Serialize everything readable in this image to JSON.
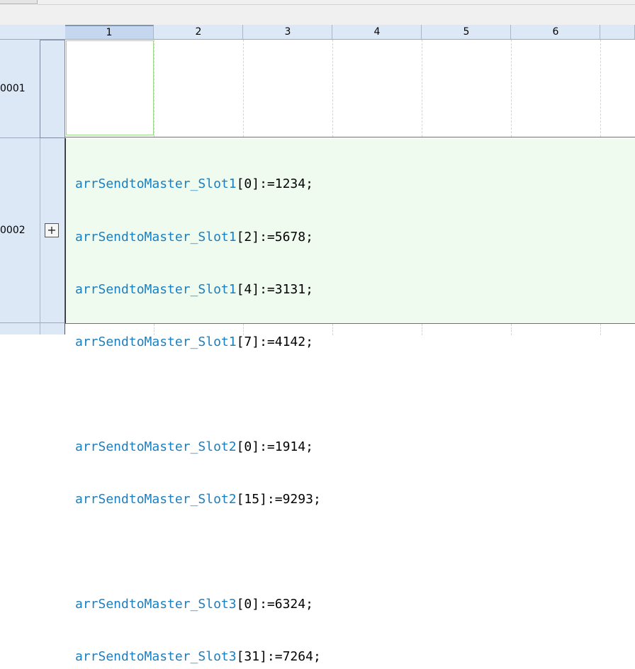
{
  "columns": [
    "1",
    "2",
    "3",
    "4",
    "5",
    "6"
  ],
  "rows": [
    {
      "number": "0001"
    },
    {
      "number": "0002",
      "expand_glyph": "+"
    }
  ],
  "code": [
    {
      "ident": "arrSendtoMaster_Slot1",
      "rest": "[0]:=1234;"
    },
    {
      "ident": "arrSendtoMaster_Slot1",
      "rest": "[2]:=5678;"
    },
    {
      "ident": "arrSendtoMaster_Slot1",
      "rest": "[4]:=3131;"
    },
    {
      "ident": "arrSendtoMaster_Slot1",
      "rest": "[7]:=4142;"
    },
    {
      "ident": "",
      "rest": ""
    },
    {
      "ident": "arrSendtoMaster_Slot2",
      "rest": "[0]:=1914;"
    },
    {
      "ident": "arrSendtoMaster_Slot2",
      "rest": "[15]:=9293;"
    },
    {
      "ident": "",
      "rest": ""
    },
    {
      "ident": "arrSendtoMaster_Slot3",
      "rest": "[0]:=6324;"
    },
    {
      "ident": "arrSendtoMaster_Slot3",
      "rest": "[31]:=7264;"
    }
  ],
  "colors": {
    "identifier": "#1a7fc1",
    "code_background": "#eefbee",
    "header_background": "#dde8f7",
    "selected_cell_border": "#9bd88a"
  }
}
